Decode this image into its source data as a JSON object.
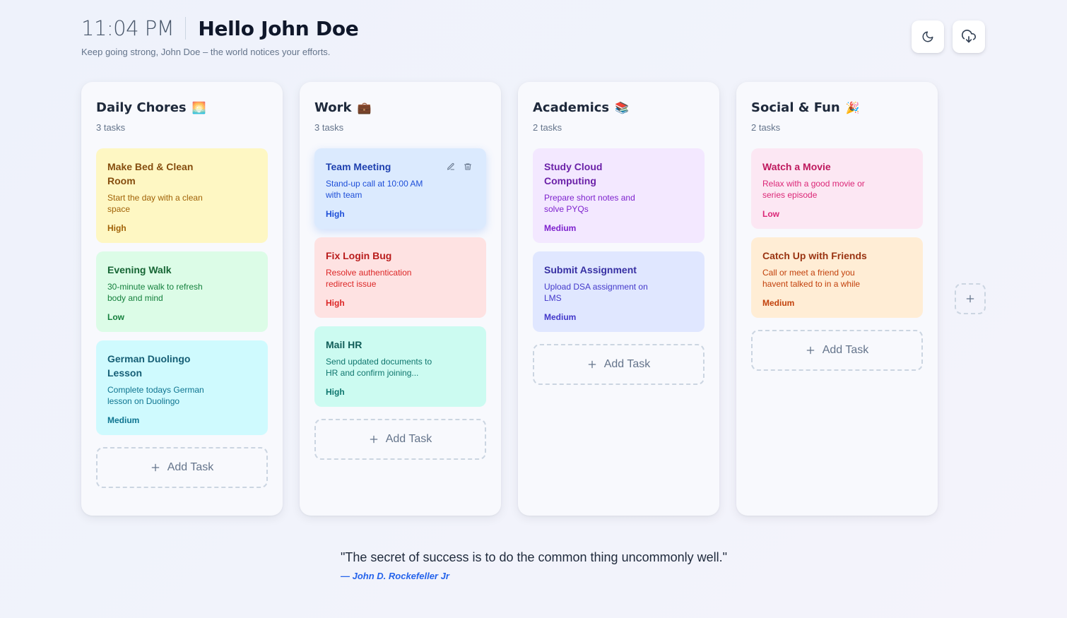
{
  "header": {
    "time": "11:04 PM",
    "greeting": "Hello John Doe",
    "subtitle": "Keep going strong, John Doe – the world notices your efforts."
  },
  "actions": {
    "theme_icon": "moon-icon",
    "download_icon": "cloud-download-icon"
  },
  "columns": [
    {
      "title": "Daily Chores",
      "emoji": "🌅",
      "count": "3 tasks",
      "cards": [
        {
          "title": "Make Bed & Clean Room",
          "desc": "Start the day with a clean space",
          "priority": "High",
          "color": "yellow"
        },
        {
          "title": "Evening Walk",
          "desc": "30-minute walk to refresh body and mind",
          "priority": "Low",
          "color": "green"
        },
        {
          "title": "German Duolingo Lesson",
          "desc": "Complete todays German lesson on Duolingo",
          "priority": "Medium",
          "color": "cyan"
        }
      ]
    },
    {
      "title": "Work",
      "emoji": "💼",
      "count": "3 tasks",
      "cards": [
        {
          "title": "Team Meeting",
          "desc": "Stand-up call at 10:00 AM with team",
          "priority": "High",
          "color": "blue"
        },
        {
          "title": "Fix Login Bug",
          "desc": "Resolve authentication redirect issue",
          "priority": "High",
          "color": "red"
        },
        {
          "title": "Mail HR",
          "desc": "Send updated documents to HR and confirm joining...",
          "priority": "High",
          "color": "teal"
        }
      ]
    },
    {
      "title": "Academics",
      "emoji": "📚",
      "count": "2 tasks",
      "cards": [
        {
          "title": "Study Cloud Computing",
          "desc": "Prepare short notes and solve PYQs",
          "priority": "Medium",
          "color": "purple"
        },
        {
          "title": "Submit Assignment",
          "desc": "Upload DSA assignment on LMS",
          "priority": "Medium",
          "color": "indigo"
        }
      ]
    },
    {
      "title": "Social & Fun",
      "emoji": "🎉",
      "count": "2 tasks",
      "cards": [
        {
          "title": "Watch a Movie",
          "desc": "Relax with a good movie or series episode",
          "priority": "Low",
          "color": "pink"
        },
        {
          "title": "Catch Up with Friends",
          "desc": "Call or meet a friend you havent talked to in a while",
          "priority": "Medium",
          "color": "orange"
        }
      ]
    }
  ],
  "add_task_label": "Add Task",
  "quote": {
    "text": "\"The secret of success is to do the common thing uncommonly well.\"",
    "author": "— John D. Rockefeller Jr"
  }
}
